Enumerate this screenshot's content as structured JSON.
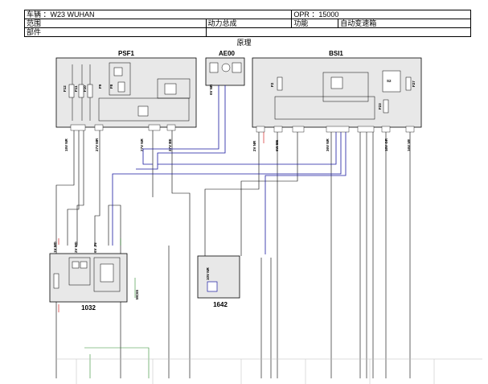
{
  "header": {
    "vehicle": "车辆 ：W23 WUHAN",
    "opr": "OPR ：15000",
    "scope_label": "范围",
    "system": "动力总成",
    "function_label": "功能",
    "function_value": "自动变速箱",
    "part_label": "部件"
  },
  "diagram": {
    "title": "原理",
    "components": {
      "psf1": "PSF1",
      "ae00": "AE00",
      "bsi1": "BSI1",
      "c1032": "1032",
      "c1642": "1642"
    },
    "fuse_labels": [
      "F12",
      "F11",
      "F10",
      "F9",
      "F8",
      "F2",
      "F23",
      "F27",
      "S2"
    ],
    "connector_labels": [
      "15V NR",
      "27V MR",
      "27V NR",
      "27V BE",
      "6V NR",
      "2V NR",
      "6W BE",
      "36V NR",
      "18V GR",
      "16V VE",
      "1V MD",
      "2V MD",
      "6V JN",
      "10V NR",
      "MC65"
    ]
  },
  "colors": {
    "wire_black": "#000000",
    "wire_blue": "#1a1aa0",
    "wire_red": "#cc0000",
    "wire_green": "#2e8b2e",
    "box_fill": "#e8e8e8",
    "grid_light": "#bdbdbd"
  }
}
